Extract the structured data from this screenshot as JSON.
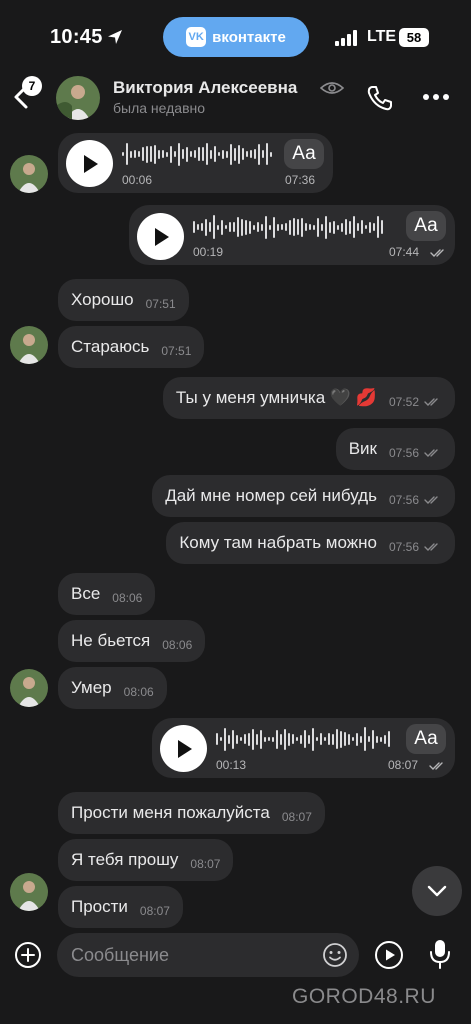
{
  "status_bar": {
    "time": "10:45",
    "vk_label": "вконтакте",
    "vk_logo": "VK",
    "network": "LTE",
    "battery": "58"
  },
  "header": {
    "back_badge": "7",
    "name": "Виктория Алексеевна",
    "status": "была недавно"
  },
  "voice_messages": [
    {
      "duration": "00:06",
      "time": "07:36",
      "transcribe_label": "Аа"
    },
    {
      "duration": "00:19",
      "time": "07:44",
      "transcribe_label": "Аа"
    },
    {
      "duration": "00:13",
      "time": "08:07",
      "transcribe_label": "Аа"
    }
  ],
  "messages": [
    {
      "text": "Хорошо",
      "time": "07:51",
      "direction": "in"
    },
    {
      "text": "Стараюсь",
      "time": "07:51",
      "direction": "in"
    },
    {
      "text": "Ты у меня умничка 🖤 💋",
      "time": "07:52",
      "direction": "out"
    },
    {
      "text": "Вик",
      "time": "07:56",
      "direction": "out"
    },
    {
      "text": "Дай мне номер сей нибудь",
      "time": "07:56",
      "direction": "out"
    },
    {
      "text": "Кому там набрать можно",
      "time": "07:56",
      "direction": "out"
    },
    {
      "text": "Все",
      "time": "08:06",
      "direction": "in"
    },
    {
      "text": "Не бьется",
      "time": "08:06",
      "direction": "in"
    },
    {
      "text": "Умер",
      "time": "08:06",
      "direction": "in"
    },
    {
      "text": "Прости меня пожалуйста",
      "time": "08:07",
      "direction": "in"
    },
    {
      "text": "Я тебя прошу",
      "time": "08:07",
      "direction": "in"
    },
    {
      "text": "Прости",
      "time": "08:07",
      "direction": "in"
    }
  ],
  "composer": {
    "placeholder": "Сообщение"
  },
  "watermark": "GOROD48.RU",
  "icons": {
    "back": "chevron-left-icon",
    "seen": "eye-icon",
    "call": "phone-icon",
    "more": "more-dots-icon",
    "play": "play-icon",
    "read": "double-check-icon",
    "scroll": "chevron-down-icon",
    "add": "plus-circle-icon",
    "emoji": "smile-icon",
    "send": "play-circle-icon",
    "mic": "microphone-icon"
  },
  "colors": {
    "background": "#19191a",
    "bubble": "#2c2c2e",
    "accent": "#62a8f0"
  }
}
